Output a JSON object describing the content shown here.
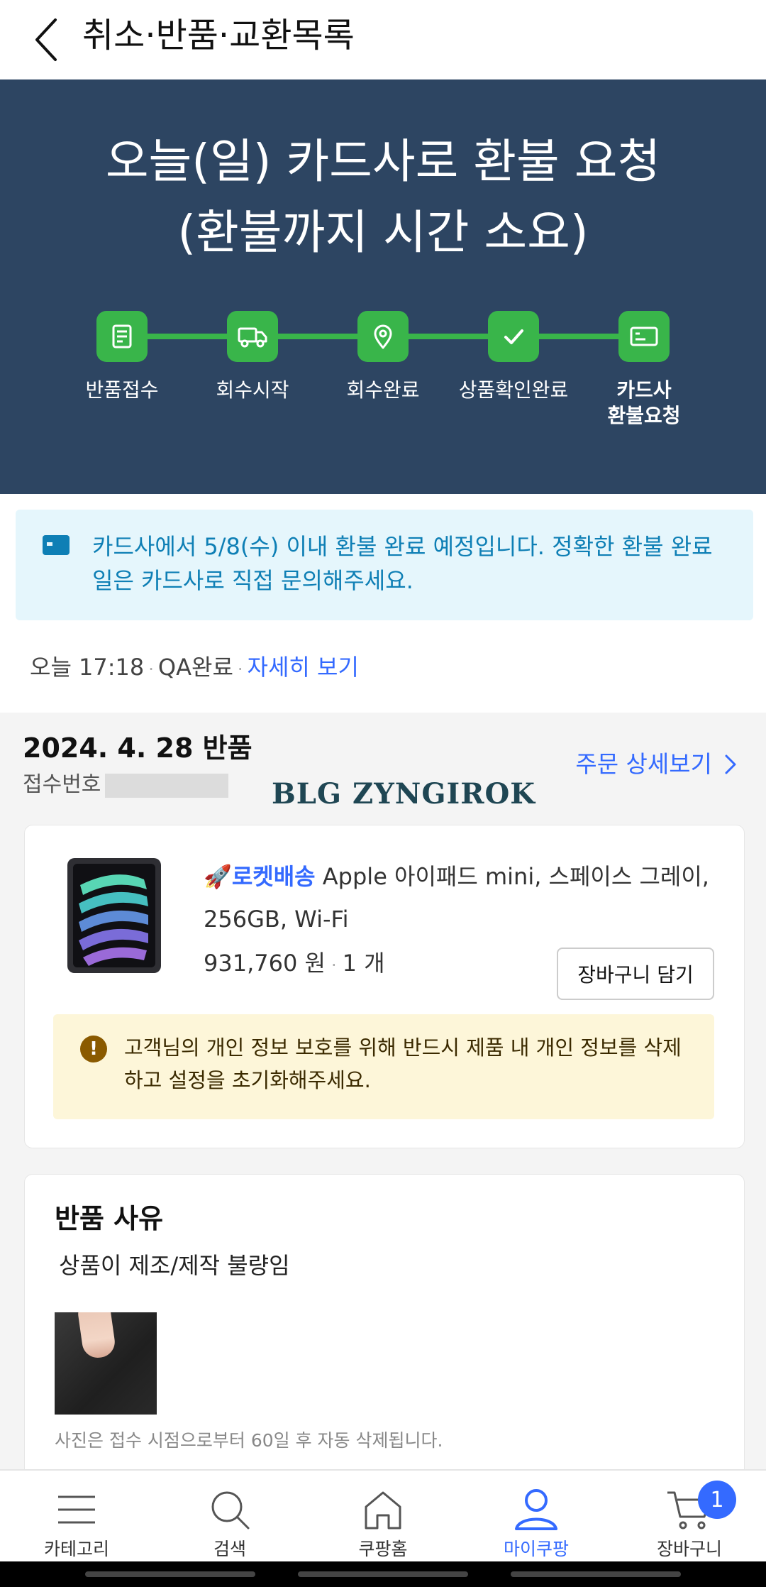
{
  "header": {
    "title": "취소·반품·교환목록"
  },
  "banner": {
    "title_line1": "오늘(일) 카드사로 환불 요청",
    "title_line2": "(환불까지 시간 소요)",
    "steps": [
      {
        "label": "반품접수",
        "icon": "receipt-icon"
      },
      {
        "label": "회수시작",
        "icon": "truck-icon"
      },
      {
        "label": "회수완료",
        "icon": "location-pin-icon"
      },
      {
        "label": "상품확인완료",
        "icon": "check-icon"
      },
      {
        "label_line1": "카드사",
        "label_line2": "환불요청",
        "icon": "card-icon",
        "active": true
      }
    ],
    "colors": {
      "background": "#2d4562",
      "step": "#39b54a"
    }
  },
  "info": {
    "text": "카드사에서 5/8(수) 이내 환불 완료 예정입니다. 정확한 환불 완료일은 카드사로 직접 문의해주세요."
  },
  "status_row": {
    "time": "오늘 17:18",
    "status": "QA완료",
    "link": "자세히 보기"
  },
  "order": {
    "date_title": "2024. 4. 28 반품",
    "receipt_label": "접수번호",
    "detail_link": "주문 상세보기",
    "watermark": "BLG ZYNGIROK"
  },
  "product": {
    "rocket_tag": "로켓배송",
    "name": "Apple 아이패드 mini, 스페이스 그레이, 256GB, Wi-Fi",
    "price": "931,760 원",
    "quantity": "1 개",
    "cart_button": "장바구니 담기",
    "warning": "고객님의 개인 정보 보호를 위해 반드시 제품 내 개인 정보를 삭제하고 설정을 초기화해주세요."
  },
  "reason": {
    "title": "반품 사유",
    "text": "상품이 제조/제작 불량임",
    "photo_note": "사진은 접수 시점으로부터 60일 후 자동 삭제됩니다."
  },
  "bottom_nav": {
    "items": [
      {
        "label": "카테고리",
        "icon": "menu-icon"
      },
      {
        "label": "검색",
        "icon": "search-icon"
      },
      {
        "label": "쿠팡홈",
        "icon": "home-icon"
      },
      {
        "label": "마이쿠팡",
        "icon": "user-icon",
        "active": true
      },
      {
        "label": "장바구니",
        "icon": "cart-icon",
        "badge": "1"
      }
    ]
  }
}
